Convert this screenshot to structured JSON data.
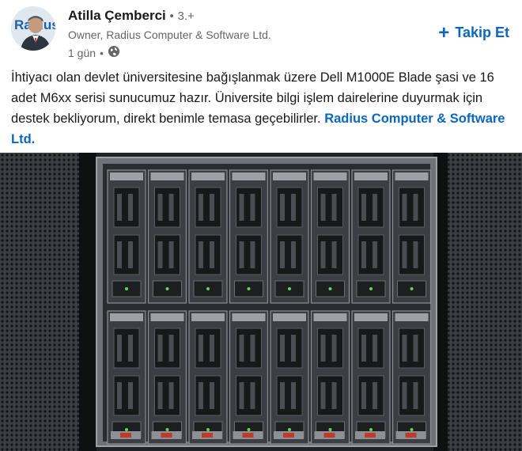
{
  "author": {
    "name": "Atilla Çemberci",
    "separator": "•",
    "degree": "3.+",
    "headline": "Owner, Radius Computer & Software Ltd.",
    "time": "1 gün",
    "logo_text": "Radius"
  },
  "actions": {
    "follow_label": "Takip Et"
  },
  "post": {
    "body": "İhtiyacı olan devlet üniversitesine bağışlanmak üzere Dell M1000E Blade şasi ve 16 adet M6xx serisi sunucumuz hazır. Üniversite bilgi işlem dairelerine duyurmak için destek bekliyorum, direkt benimle temasa geçebilirler.",
    "mention": "Radius Computer & Software Ltd."
  },
  "colors": {
    "accent": "#0a66c2",
    "text": "#191919",
    "muted": "#666666"
  },
  "icons": {
    "follow": "plus-icon",
    "visibility": "globe-icon"
  }
}
